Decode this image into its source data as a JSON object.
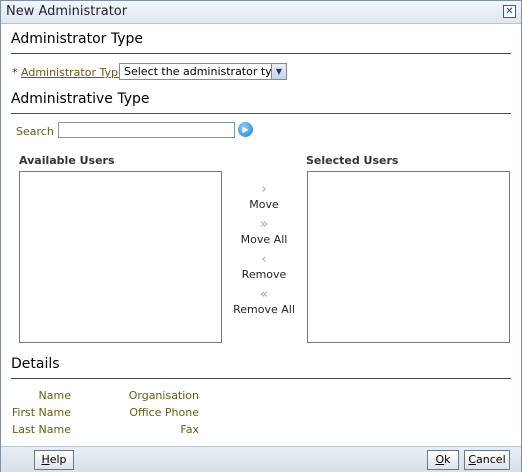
{
  "window": {
    "title": "New Administrator",
    "close_icon": "close-icon"
  },
  "admin_type_section": {
    "title": "Administrator Type",
    "required_mark": "*",
    "field_label": "Administrator Type",
    "select_value": "Select the administrator type"
  },
  "administrative_type_section": {
    "title": "Administrative Type",
    "search_label": "Search",
    "search_value": "",
    "available_users_label": "Available Users",
    "selected_users_label": "Selected Users",
    "available_users": [],
    "selected_users": [],
    "shuttle": {
      "move": "Move",
      "move_all": "Move All",
      "remove": "Remove",
      "remove_all": "Remove All"
    }
  },
  "details_section": {
    "title": "Details",
    "name": "Name",
    "first_name": "First Name",
    "last_name": "Last Name",
    "organisation": "Organisation",
    "office_phone": "Office Phone",
    "fax": "Fax"
  },
  "footer": {
    "help_prefix": "",
    "help_accel": "H",
    "help_rest": "elp",
    "ok_accel": "O",
    "ok_rest": "k",
    "cancel_accel": "C",
    "cancel_rest": "ancel"
  }
}
